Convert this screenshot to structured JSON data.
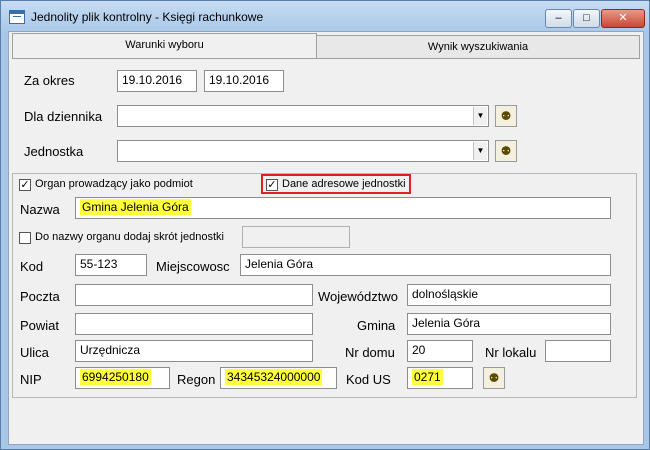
{
  "window": {
    "title": "Jednolity plik kontrolny - Księgi rachunkowe",
    "min": "–",
    "max": "□",
    "close": "✕"
  },
  "tabs": [
    "Warunki wyboru",
    "Wynik wyszukiwania"
  ],
  "form": {
    "okres_label": "Za okres",
    "okres_od": "19.10.2016",
    "okres_do": "19.10.2016",
    "dziennik_label": "Dla dziennika",
    "dziennik_value": "",
    "jednostka_label": "Jednostka",
    "jednostka_value": ""
  },
  "checkboxes": {
    "organ_label": "Organ prowadzący jako podmiot",
    "organ_checked": "✓",
    "dane_label": "Dane adresowe jednostki",
    "dane_checked": "✓",
    "skrot_label": "Do nazwy organu dodaj skrót jednostki",
    "skrot_checked": ""
  },
  "address": {
    "nazwa_label": "Nazwa",
    "nazwa": "Gmina Jelenia Góra",
    "kod_label": "Kod",
    "kod": "55-123",
    "miejscowosc_label": "Miejscowosc",
    "miejscowosc": "Jelenia Góra",
    "poczta_label": "Poczta",
    "poczta": "",
    "wojewodztwo_label": "Województwo",
    "wojewodztwo": "dolnośląskie",
    "powiat_label": "Powiat",
    "powiat": "",
    "gmina_label": "Gmina",
    "gmina": "Jelenia Góra",
    "ulica_label": "Ulica",
    "ulica": "Urzędnicza",
    "nr_domu_label": "Nr domu",
    "nr_domu": "20",
    "nr_lokalu_label": "Nr lokalu",
    "nr_lokalu": "",
    "nip_label": "NIP",
    "nip": "6994250180",
    "regon_label": "Regon",
    "regon": "34345324000000",
    "kod_us_label": "Kod US",
    "kod_us": "0271"
  },
  "icons": {
    "binoculars": "binoculars-icon",
    "dropdown": "▼"
  },
  "colors": {
    "highlight": "#ffff3c",
    "frame": "#a9c6e6",
    "attention": "#e02020"
  }
}
